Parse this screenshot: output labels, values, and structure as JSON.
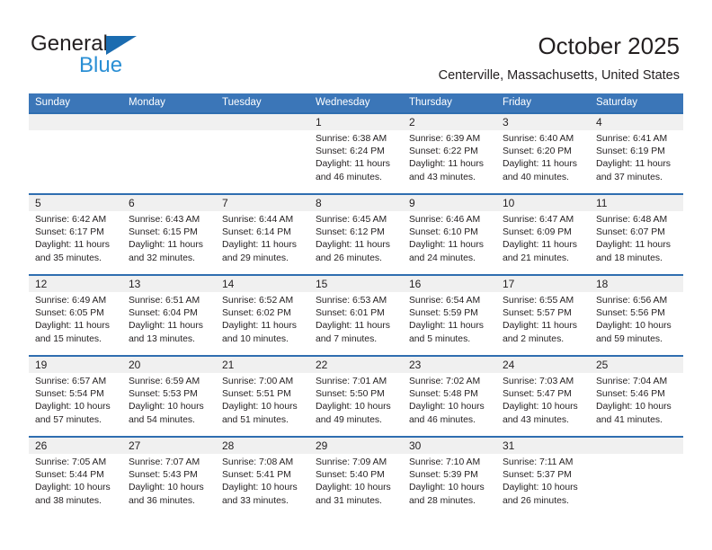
{
  "brand": {
    "name_top": "General",
    "name_bottom": "Blue",
    "triangle_color": "#1b6cb0",
    "blue_color": "#2a8fd4"
  },
  "header": {
    "title": "October 2025",
    "subtitle": "Centerville, Massachusetts, United States"
  },
  "theme": {
    "header_blue": "#3b76b8",
    "row_rule_blue": "#2f6eb0",
    "date_band_gray": "#f0f0f0",
    "text_color": "#231f20"
  },
  "calendar": {
    "day_headers": [
      "Sunday",
      "Monday",
      "Tuesday",
      "Wednesday",
      "Thursday",
      "Friday",
      "Saturday"
    ],
    "labels": {
      "sunrise": "Sunrise:",
      "sunset": "Sunset:",
      "daylight": "Daylight:"
    },
    "weeks": [
      [
        {
          "day": "",
          "sunrise": "",
          "sunset": "",
          "daylight": ""
        },
        {
          "day": "",
          "sunrise": "",
          "sunset": "",
          "daylight": ""
        },
        {
          "day": "",
          "sunrise": "",
          "sunset": "",
          "daylight": ""
        },
        {
          "day": "1",
          "sunrise": "Sunrise: 6:38 AM",
          "sunset": "Sunset: 6:24 PM",
          "daylight": "Daylight: 11 hours and 46 minutes."
        },
        {
          "day": "2",
          "sunrise": "Sunrise: 6:39 AM",
          "sunset": "Sunset: 6:22 PM",
          "daylight": "Daylight: 11 hours and 43 minutes."
        },
        {
          "day": "3",
          "sunrise": "Sunrise: 6:40 AM",
          "sunset": "Sunset: 6:20 PM",
          "daylight": "Daylight: 11 hours and 40 minutes."
        },
        {
          "day": "4",
          "sunrise": "Sunrise: 6:41 AM",
          "sunset": "Sunset: 6:19 PM",
          "daylight": "Daylight: 11 hours and 37 minutes."
        }
      ],
      [
        {
          "day": "5",
          "sunrise": "Sunrise: 6:42 AM",
          "sunset": "Sunset: 6:17 PM",
          "daylight": "Daylight: 11 hours and 35 minutes."
        },
        {
          "day": "6",
          "sunrise": "Sunrise: 6:43 AM",
          "sunset": "Sunset: 6:15 PM",
          "daylight": "Daylight: 11 hours and 32 minutes."
        },
        {
          "day": "7",
          "sunrise": "Sunrise: 6:44 AM",
          "sunset": "Sunset: 6:14 PM",
          "daylight": "Daylight: 11 hours and 29 minutes."
        },
        {
          "day": "8",
          "sunrise": "Sunrise: 6:45 AM",
          "sunset": "Sunset: 6:12 PM",
          "daylight": "Daylight: 11 hours and 26 minutes."
        },
        {
          "day": "9",
          "sunrise": "Sunrise: 6:46 AM",
          "sunset": "Sunset: 6:10 PM",
          "daylight": "Daylight: 11 hours and 24 minutes."
        },
        {
          "day": "10",
          "sunrise": "Sunrise: 6:47 AM",
          "sunset": "Sunset: 6:09 PM",
          "daylight": "Daylight: 11 hours and 21 minutes."
        },
        {
          "day": "11",
          "sunrise": "Sunrise: 6:48 AM",
          "sunset": "Sunset: 6:07 PM",
          "daylight": "Daylight: 11 hours and 18 minutes."
        }
      ],
      [
        {
          "day": "12",
          "sunrise": "Sunrise: 6:49 AM",
          "sunset": "Sunset: 6:05 PM",
          "daylight": "Daylight: 11 hours and 15 minutes."
        },
        {
          "day": "13",
          "sunrise": "Sunrise: 6:51 AM",
          "sunset": "Sunset: 6:04 PM",
          "daylight": "Daylight: 11 hours and 13 minutes."
        },
        {
          "day": "14",
          "sunrise": "Sunrise: 6:52 AM",
          "sunset": "Sunset: 6:02 PM",
          "daylight": "Daylight: 11 hours and 10 minutes."
        },
        {
          "day": "15",
          "sunrise": "Sunrise: 6:53 AM",
          "sunset": "Sunset: 6:01 PM",
          "daylight": "Daylight: 11 hours and 7 minutes."
        },
        {
          "day": "16",
          "sunrise": "Sunrise: 6:54 AM",
          "sunset": "Sunset: 5:59 PM",
          "daylight": "Daylight: 11 hours and 5 minutes."
        },
        {
          "day": "17",
          "sunrise": "Sunrise: 6:55 AM",
          "sunset": "Sunset: 5:57 PM",
          "daylight": "Daylight: 11 hours and 2 minutes."
        },
        {
          "day": "18",
          "sunrise": "Sunrise: 6:56 AM",
          "sunset": "Sunset: 5:56 PM",
          "daylight": "Daylight: 10 hours and 59 minutes."
        }
      ],
      [
        {
          "day": "19",
          "sunrise": "Sunrise: 6:57 AM",
          "sunset": "Sunset: 5:54 PM",
          "daylight": "Daylight: 10 hours and 57 minutes."
        },
        {
          "day": "20",
          "sunrise": "Sunrise: 6:59 AM",
          "sunset": "Sunset: 5:53 PM",
          "daylight": "Daylight: 10 hours and 54 minutes."
        },
        {
          "day": "21",
          "sunrise": "Sunrise: 7:00 AM",
          "sunset": "Sunset: 5:51 PM",
          "daylight": "Daylight: 10 hours and 51 minutes."
        },
        {
          "day": "22",
          "sunrise": "Sunrise: 7:01 AM",
          "sunset": "Sunset: 5:50 PM",
          "daylight": "Daylight: 10 hours and 49 minutes."
        },
        {
          "day": "23",
          "sunrise": "Sunrise: 7:02 AM",
          "sunset": "Sunset: 5:48 PM",
          "daylight": "Daylight: 10 hours and 46 minutes."
        },
        {
          "day": "24",
          "sunrise": "Sunrise: 7:03 AM",
          "sunset": "Sunset: 5:47 PM",
          "daylight": "Daylight: 10 hours and 43 minutes."
        },
        {
          "day": "25",
          "sunrise": "Sunrise: 7:04 AM",
          "sunset": "Sunset: 5:46 PM",
          "daylight": "Daylight: 10 hours and 41 minutes."
        }
      ],
      [
        {
          "day": "26",
          "sunrise": "Sunrise: 7:05 AM",
          "sunset": "Sunset: 5:44 PM",
          "daylight": "Daylight: 10 hours and 38 minutes."
        },
        {
          "day": "27",
          "sunrise": "Sunrise: 7:07 AM",
          "sunset": "Sunset: 5:43 PM",
          "daylight": "Daylight: 10 hours and 36 minutes."
        },
        {
          "day": "28",
          "sunrise": "Sunrise: 7:08 AM",
          "sunset": "Sunset: 5:41 PM",
          "daylight": "Daylight: 10 hours and 33 minutes."
        },
        {
          "day": "29",
          "sunrise": "Sunrise: 7:09 AM",
          "sunset": "Sunset: 5:40 PM",
          "daylight": "Daylight: 10 hours and 31 minutes."
        },
        {
          "day": "30",
          "sunrise": "Sunrise: 7:10 AM",
          "sunset": "Sunset: 5:39 PM",
          "daylight": "Daylight: 10 hours and 28 minutes."
        },
        {
          "day": "31",
          "sunrise": "Sunrise: 7:11 AM",
          "sunset": "Sunset: 5:37 PM",
          "daylight": "Daylight: 10 hours and 26 minutes."
        },
        {
          "day": "",
          "sunrise": "",
          "sunset": "",
          "daylight": ""
        }
      ]
    ]
  }
}
